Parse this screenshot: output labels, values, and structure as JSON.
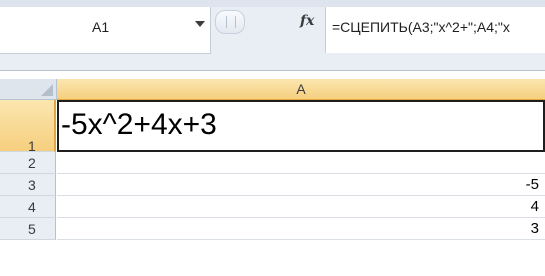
{
  "formula_bar": {
    "name_box": "A1",
    "fx_symbol": "fx",
    "formula": "=СЦЕПИТЬ(A3;\"x^2+\";A4;\"x"
  },
  "grid": {
    "column_header": "A",
    "rows": [
      {
        "number": "1",
        "value": "-5x^2+4x+3"
      },
      {
        "number": "2",
        "value": ""
      },
      {
        "number": "3",
        "value": "-5"
      },
      {
        "number": "4",
        "value": "4"
      },
      {
        "number": "5",
        "value": "3"
      }
    ]
  },
  "colors": {
    "selection_header": "#f6cf7e",
    "header_background": "#e9eef5",
    "selection_border": "#1e1e1e"
  }
}
